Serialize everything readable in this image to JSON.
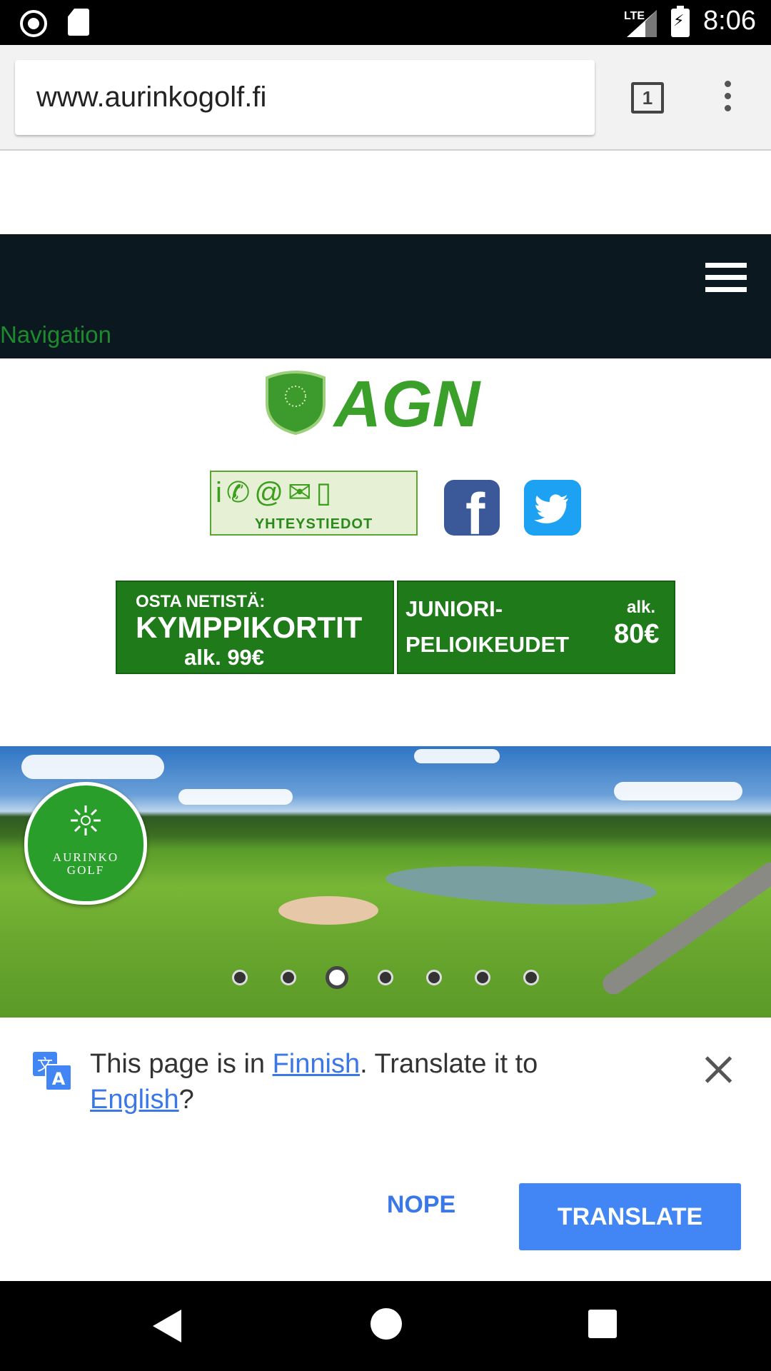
{
  "status_bar": {
    "network": "LTE",
    "time": "8:06"
  },
  "browser": {
    "url": "www.aurinkogolf.fi",
    "tab_count": "1"
  },
  "page": {
    "nav_label": "Navigation",
    "logo_text": "AGN",
    "contact_banner_label": "YHTEYSTIEDOT",
    "promo_left": {
      "line1": "OSTA NETISTÄ:",
      "line2": "KYMPPIKORTIT",
      "line3": "alk. 99€"
    },
    "promo_right": {
      "line1": "JUNIORI-",
      "line2": "PELIOIKEUDET",
      "alk": "alk.",
      "price": "80€"
    },
    "hero_logo_line1": "AURINKO",
    "hero_logo_line2": "GOLF",
    "slideshow": {
      "total": 7,
      "active_index": 3
    }
  },
  "translate_bar": {
    "text_prefix": "This page is in ",
    "source_language": "Finnish",
    "text_middle": ". Translate it to ",
    "target_language": "English",
    "text_suffix": "?",
    "nope_label": "NOPE",
    "translate_label": "TRANSLATE"
  },
  "colors": {
    "nav_bg": "#0b1820",
    "promo_green": "#1f7a1a",
    "link_blue": "#3b78e7",
    "translate_button": "#4285f4",
    "facebook": "#3b5998",
    "twitter": "#1da1f2"
  },
  "icons": [
    "record-icon",
    "sd-card-icon",
    "signal-icon",
    "battery-charging-icon",
    "tab-switcher-icon",
    "overflow-menu-icon",
    "hamburger-menu-icon",
    "facebook-icon",
    "twitter-icon",
    "google-translate-icon",
    "close-icon",
    "back-icon",
    "home-icon",
    "recents-icon"
  ]
}
